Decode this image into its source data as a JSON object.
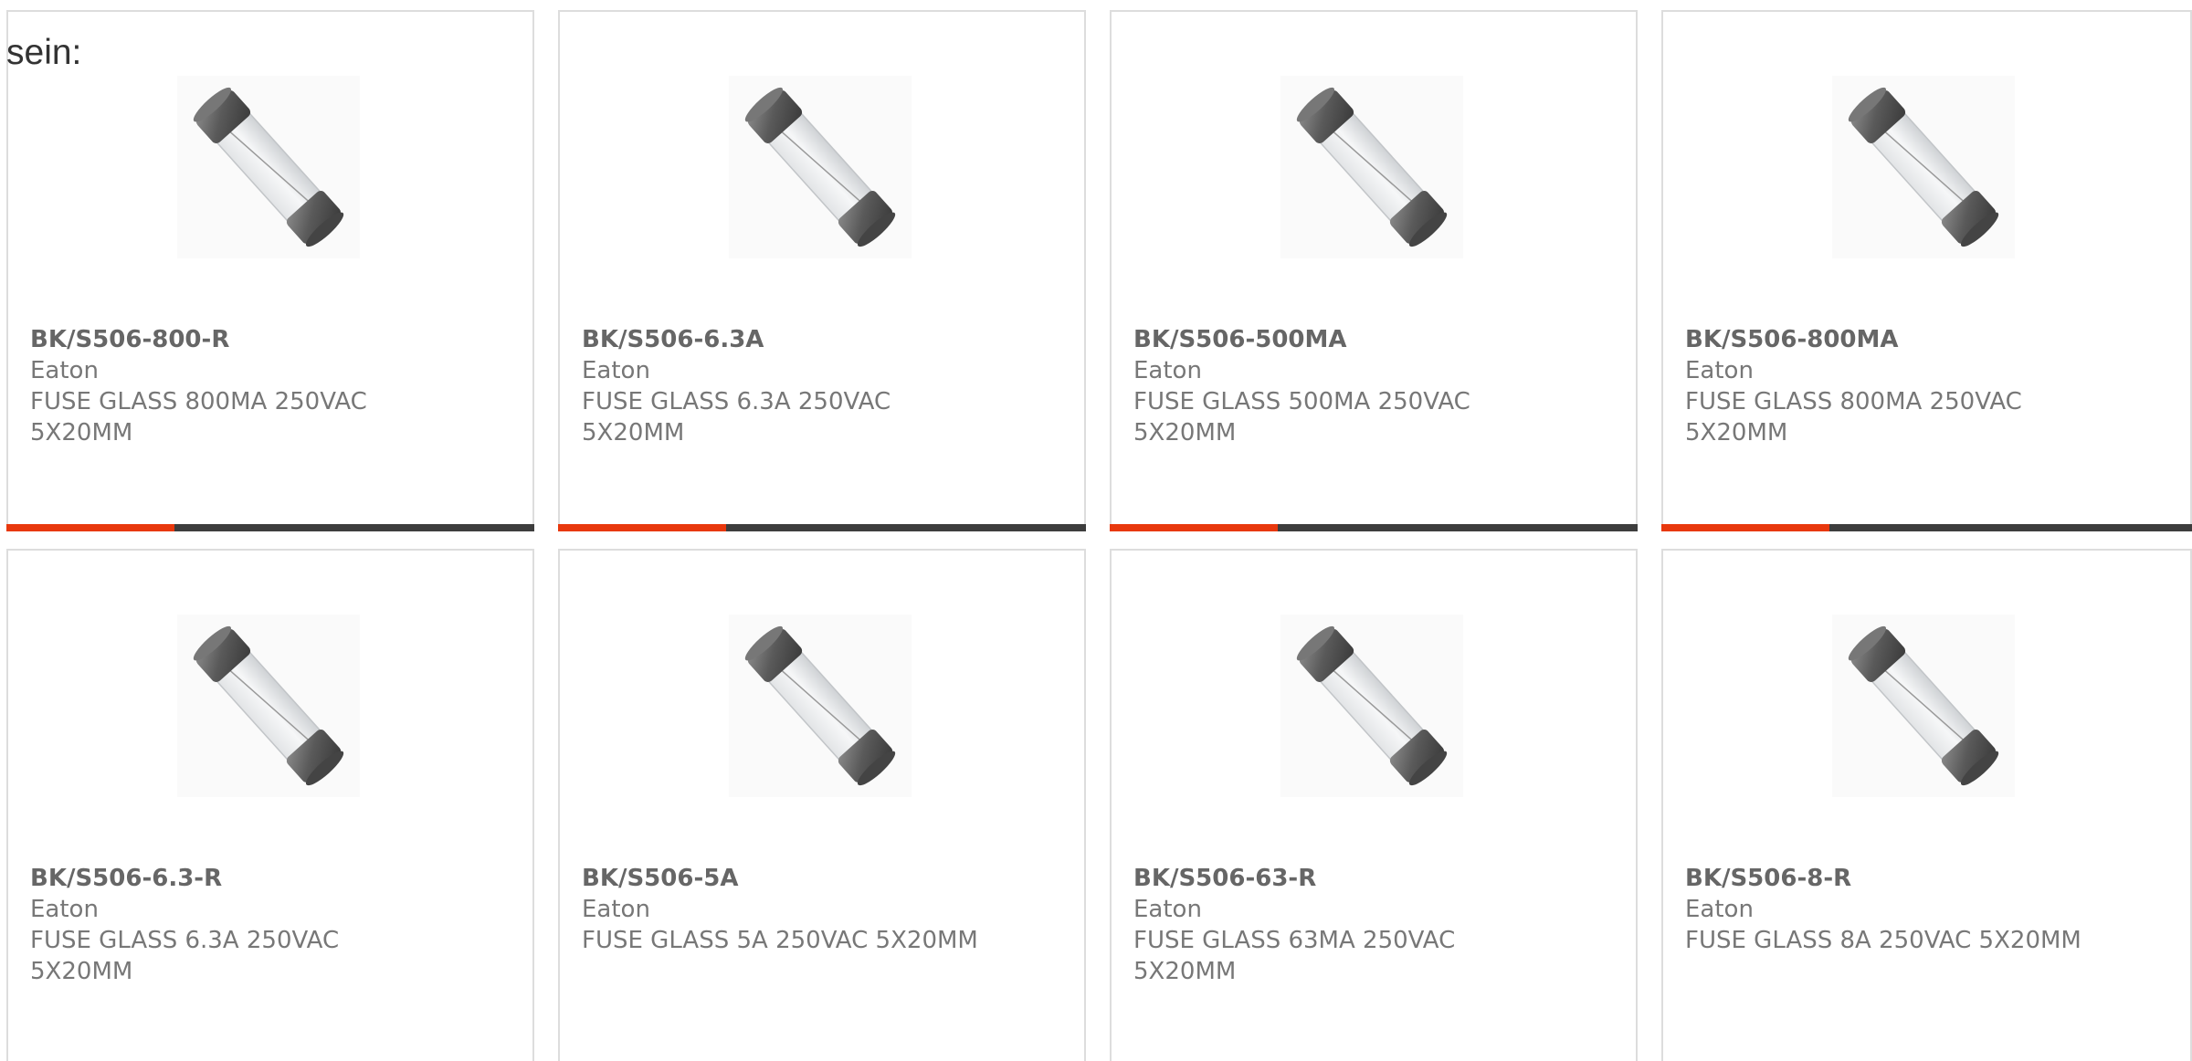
{
  "intro_text": "sein:",
  "colors": {
    "accent": "#e8380d",
    "bar": "#3d3d3d",
    "border": "#dddddd",
    "text": "#777777"
  },
  "image_icon": "glass-fuse-image",
  "products": [
    {
      "part": "BK/S506-800-R",
      "manufacturer": "Eaton",
      "description": "FUSE GLASS 800MA 250VAC 5X20MM"
    },
    {
      "part": "BK/S506-6.3A",
      "manufacturer": "Eaton",
      "description": "FUSE GLASS 6.3A 250VAC 5X20MM"
    },
    {
      "part": "BK/S506-500MA",
      "manufacturer": "Eaton",
      "description": "FUSE GLASS 500MA 250VAC 5X20MM"
    },
    {
      "part": "BK/S506-800MA",
      "manufacturer": "Eaton",
      "description": "FUSE GLASS 800MA 250VAC 5X20MM"
    },
    {
      "part": "BK/S506-6.3-R",
      "manufacturer": "Eaton",
      "description": "FUSE GLASS 6.3A 250VAC 5X20MM"
    },
    {
      "part": "BK/S506-5A",
      "manufacturer": "Eaton",
      "description": "FUSE GLASS 5A 250VAC 5X20MM"
    },
    {
      "part": "BK/S506-63-R",
      "manufacturer": "Eaton",
      "description": "FUSE GLASS 63MA 250VAC 5X20MM"
    },
    {
      "part": "BK/S506-8-R",
      "manufacturer": "Eaton",
      "description": "FUSE GLASS 8A 250VAC 5X20MM"
    }
  ]
}
